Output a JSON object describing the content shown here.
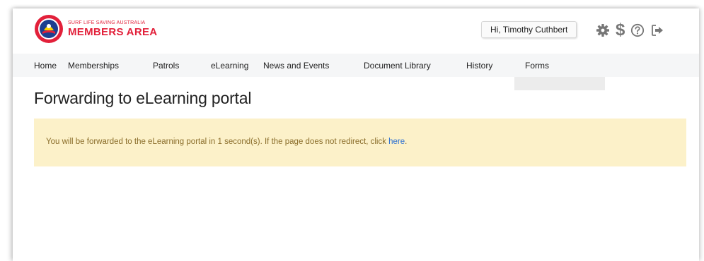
{
  "brand": {
    "subtitle": "SURF LIFE SAVING AUSTRALIA",
    "title": "MEMBERS AREA"
  },
  "user": {
    "greeting": "Hi, Timothy Cuthbert"
  },
  "header_icons": [
    "gear-icon",
    "dollar-icon",
    "help-icon",
    "logout-icon"
  ],
  "nav": {
    "items": [
      "Home",
      "Memberships",
      "Patrols",
      "eLearning",
      "News and Events",
      "Document Library",
      "History",
      "Forms"
    ]
  },
  "page": {
    "title": "Forwarding to eLearning portal"
  },
  "alert": {
    "message": "You will be forwarded to the eLearning portal in 1 second(s). If the page does not redirect, click ",
    "link_text": "here",
    "suffix": "."
  },
  "colors": {
    "brand_red": "#e2203a",
    "alert_bg": "#fcf1c9",
    "alert_text": "#8a6d2a",
    "link": "#2b6fd1"
  }
}
